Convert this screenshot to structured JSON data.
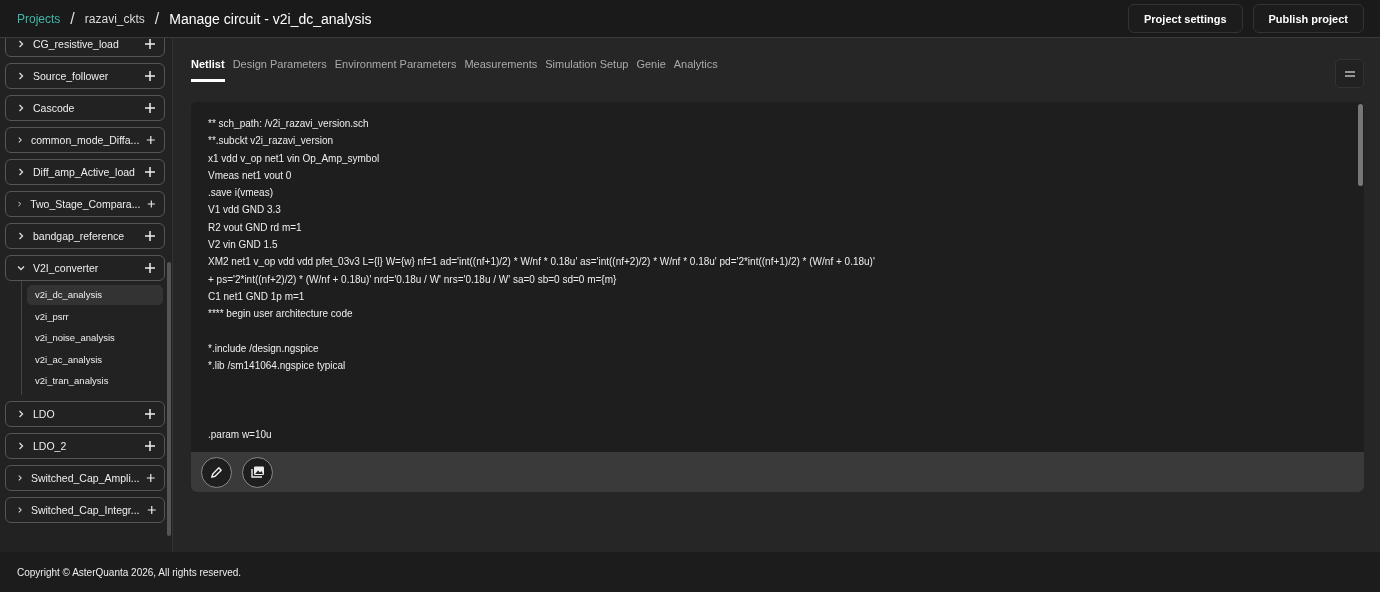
{
  "breadcrumb": [
    {
      "label": "Projects",
      "kind": "link"
    },
    {
      "label": "razavi_ckts",
      "kind": "crumb"
    },
    {
      "label": "Manage circuit - v2i_dc_analysis",
      "kind": "current"
    }
  ],
  "breadcrumb_separators": [
    "/",
    "/"
  ],
  "header_buttons": [
    "Project settings",
    "Publish project"
  ],
  "sidebar": {
    "items": [
      {
        "label": "CG_resistive_load",
        "expanded": false
      },
      {
        "label": "Source_follower",
        "expanded": false
      },
      {
        "label": "Cascode",
        "expanded": false
      },
      {
        "label": "common_mode_Diffa...",
        "expanded": false
      },
      {
        "label": "Diff_amp_Active_load",
        "expanded": false
      },
      {
        "label": "Two_Stage_Compara...",
        "expanded": false
      },
      {
        "label": "bandgap_reference",
        "expanded": false
      },
      {
        "label": "V2I_converter",
        "expanded": true,
        "children": [
          {
            "label": "v2i_dc_analysis",
            "selected": true
          },
          {
            "label": "v2i_psrr",
            "selected": false
          },
          {
            "label": "v2i_noise_analysis",
            "selected": false
          },
          {
            "label": "v2i_ac_analysis",
            "selected": false
          },
          {
            "label": "v2i_tran_analysis",
            "selected": false
          }
        ]
      },
      {
        "label": "LDO",
        "expanded": false
      },
      {
        "label": "LDO_2",
        "expanded": false
      },
      {
        "label": "Switched_Cap_Ampli...",
        "expanded": false
      },
      {
        "label": "Switched_Cap_Integr...",
        "expanded": false
      }
    ]
  },
  "tabs": [
    {
      "label": "Netlist",
      "selected": true
    },
    {
      "label": "Design Parameters",
      "selected": false
    },
    {
      "label": "Environment Parameters",
      "selected": false
    },
    {
      "label": "Measurements",
      "selected": false
    },
    {
      "label": "Simulation Setup",
      "selected": false
    },
    {
      "label": "Genie",
      "selected": false
    },
    {
      "label": "Analytics",
      "selected": false
    }
  ],
  "netlist": {
    "blocks": [
      [
        "** sch_path: /v2i_razavi_version.sch",
        "**.subckt v2i_razavi_version",
        "x1 vdd v_op net1 vin Op_Amp_symbol",
        "Vmeas net1 vout 0",
        ".save i(vmeas)",
        "V1 vdd GND 3.3",
        "R2 vout GND rd m=1",
        "V2 vin GND 1.5",
        "XM2 net1 v_op vdd vdd pfet_03v3 L={l} W={w} nf=1 ad='int((nf+1)/2) * W/nf * 0.18u' as='int((nf+2)/2) * W/nf * 0.18u' pd='2*int((nf+1)/2) * (W/nf + 0.18u)'",
        "+ ps='2*int((nf+2)/2) * (W/nf + 0.18u)' nrd='0.18u / W' nrs='0.18u / W' sa=0 sb=0 sd=0 m={m}",
        "C1 net1 GND 1p m=1",
        "**** begin user architecture code"
      ],
      [
        "*.include /design.ngspice",
        "*.lib /sm141064.ngspice typical"
      ],
      [
        ".param w=10u"
      ]
    ]
  },
  "footer": "Copyright © AsterQuanta 2026, All rights reserved."
}
